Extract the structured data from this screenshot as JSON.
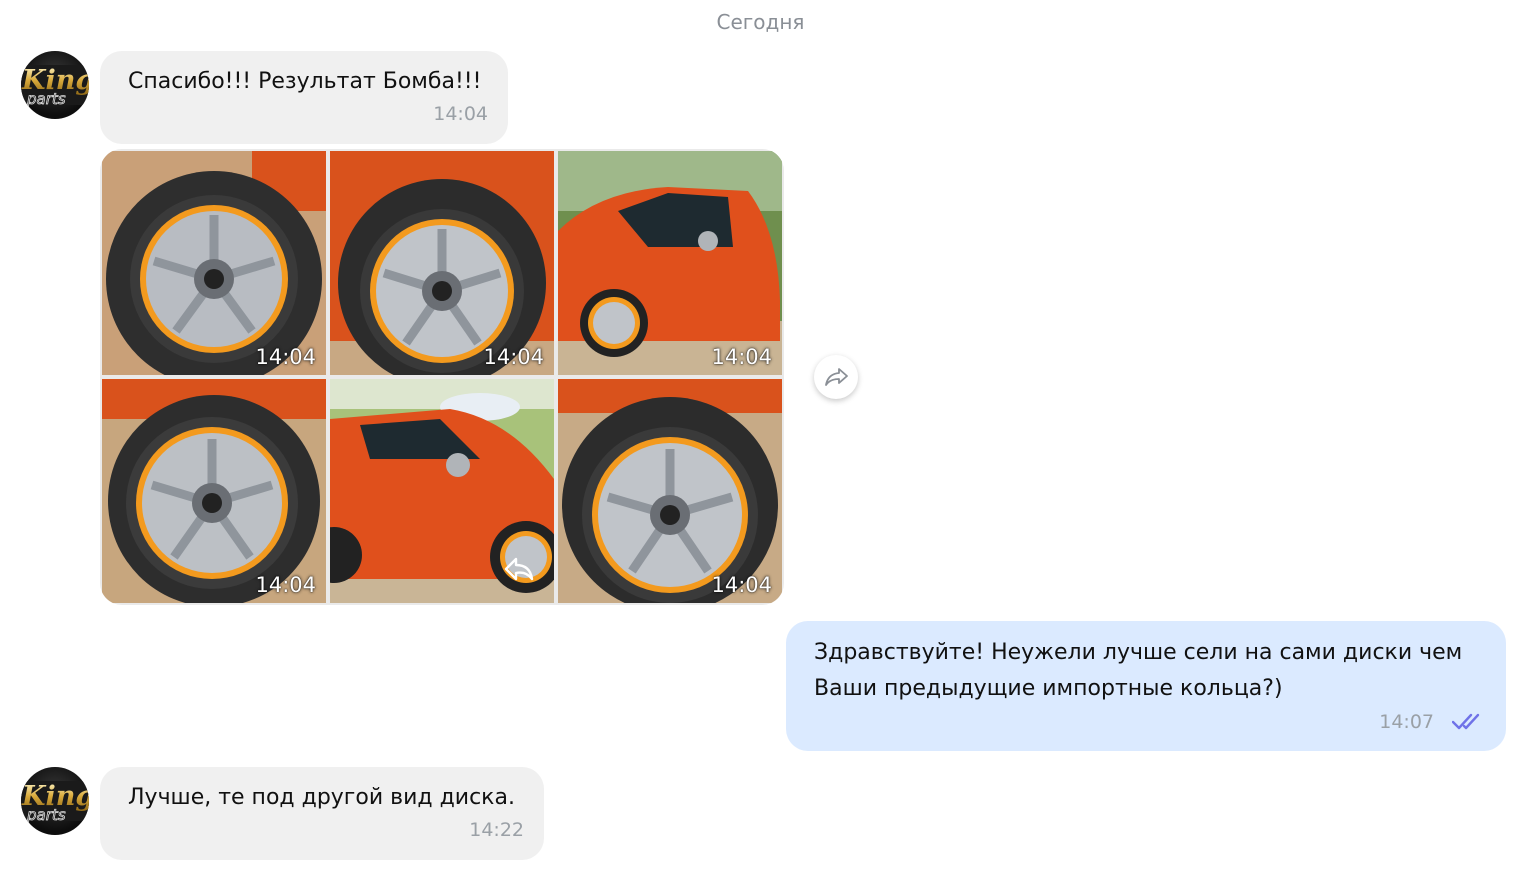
{
  "chat": {
    "date_separator": "Сегодня",
    "messages": [
      {
        "direction": "in",
        "text": "Спасибо!!! Результат Бомба!!!",
        "time": "14:04"
      },
      {
        "direction": "in",
        "type": "photos",
        "photos": [
          {
            "label": "wheel closeup with orange rim",
            "time": "14:04"
          },
          {
            "label": "wheel closeup with orange rim",
            "time": "14:04"
          },
          {
            "label": "orange car side view",
            "time": "14:04"
          },
          {
            "label": "wheel closeup with orange rim",
            "time": "14:04"
          },
          {
            "label": "orange car side view",
            "time": ""
          },
          {
            "label": "wheel closeup with orange rim",
            "time": "14:04"
          }
        ]
      },
      {
        "direction": "out",
        "text_lines": [
          "Здравствуйте! Неужели лучше сели на сами диски чем",
          "Ваши предыдущие импортные кольца?)"
        ],
        "time": "14:07",
        "status": "read-double-check-icon"
      },
      {
        "direction": "in",
        "text": "Лучше, те под другой вид диска.",
        "time": "14:22"
      }
    ],
    "avatar_text": [
      "King",
      "parts"
    ]
  },
  "colors": {
    "incoming_bubble": "#f0f0f0",
    "outgoing_bubble": "#dbeaff",
    "read_check": "#6f72e8",
    "rim_accent": "#f39a1e",
    "car_body": "#e0501c"
  }
}
